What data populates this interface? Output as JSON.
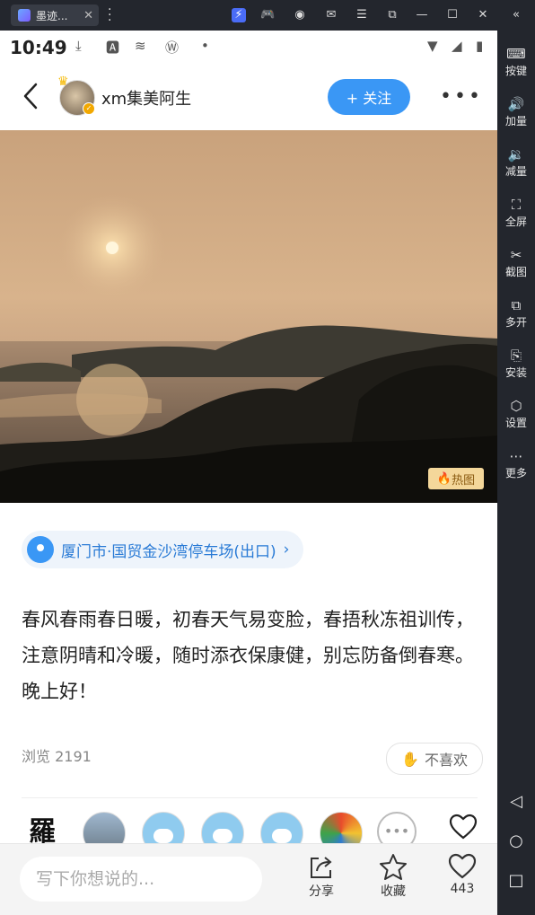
{
  "emulator": {
    "tab_title": "墨迹...",
    "tab_close": "✕",
    "menu_dots": "⋮",
    "sidebar": [
      {
        "icon": "keyboard-icon",
        "label": "按键",
        "glyph": "⌨"
      },
      {
        "icon": "volume-up-icon",
        "label": "加量",
        "glyph": "🔊"
      },
      {
        "icon": "volume-down-icon",
        "label": "减量",
        "glyph": "🔉"
      },
      {
        "icon": "fullscreen-icon",
        "label": "全屏",
        "glyph": "⛶"
      },
      {
        "icon": "scissors-icon",
        "label": "截图",
        "glyph": "✂"
      },
      {
        "icon": "multi-open-icon",
        "label": "多开",
        "glyph": "⧉"
      },
      {
        "icon": "apk-install-icon",
        "label": "安装",
        "glyph": "⎘"
      },
      {
        "icon": "settings-icon",
        "label": "设置",
        "glyph": "⬡"
      },
      {
        "icon": "more-icon",
        "label": "更多",
        "glyph": "⋯"
      }
    ],
    "android_nav": {
      "back": "◁",
      "home": "○",
      "recents": "□"
    }
  },
  "status_bar": {
    "time": "10:49"
  },
  "post": {
    "username": "xm集美阿生",
    "follow_label": "+ 关注",
    "more_label": "•••",
    "hot_badge": "热图",
    "location": "厦门市·国贸金沙湾停车场(出口)",
    "location_chevron": "›",
    "content": "春风春雨春日暖，初春天气易变脸，春捂秋冻祖训传，注意阴晴和冷暖，随时添衣保康健，别忘防备倒春寒。晚上好！",
    "views": "浏览 2191",
    "dislike_label": "不喜欢",
    "likers_more": "•••",
    "liker_text_avatar": "羅"
  },
  "bottom_bar": {
    "comment_placeholder": "写下你想说的...",
    "share_label": "分享",
    "favorite_label": "收藏",
    "like_count": "443"
  },
  "colors": {
    "accent": "#3a97f5",
    "emulator_bg": "#23262d",
    "hot_badge_bg": "#f4d79a"
  }
}
